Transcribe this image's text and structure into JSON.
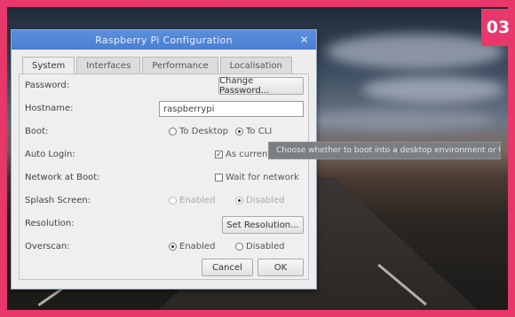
{
  "badge": "03",
  "dialog": {
    "title": "Raspberry Pi Configuration",
    "tabs": [
      "System",
      "Interfaces",
      "Performance",
      "Localisation"
    ],
    "active_tab": 0,
    "password_label": "Password:",
    "change_password": "Change Password...",
    "hostname_label": "Hostname:",
    "hostname_value": "raspberrypi",
    "boot_label": "Boot:",
    "boot_desktop": "To Desktop",
    "boot_cli": "To CLI",
    "autologin_label": "Auto Login:",
    "autologin_option": "As current user",
    "network_label": "Network at Boot:",
    "network_option": "Wait for network",
    "splash_label": "Splash Screen:",
    "splash_enabled": "Enabled",
    "splash_disabled": "Disabled",
    "resolution_label": "Resolution:",
    "resolution_button": "Set Resolution...",
    "overscan_label": "Overscan:",
    "overscan_enabled": "Enabled",
    "overscan_disabled": "Disabled",
    "cancel": "Cancel",
    "ok": "OK"
  },
  "tooltip": "Choose whether to boot into a desktop environment or the command line"
}
